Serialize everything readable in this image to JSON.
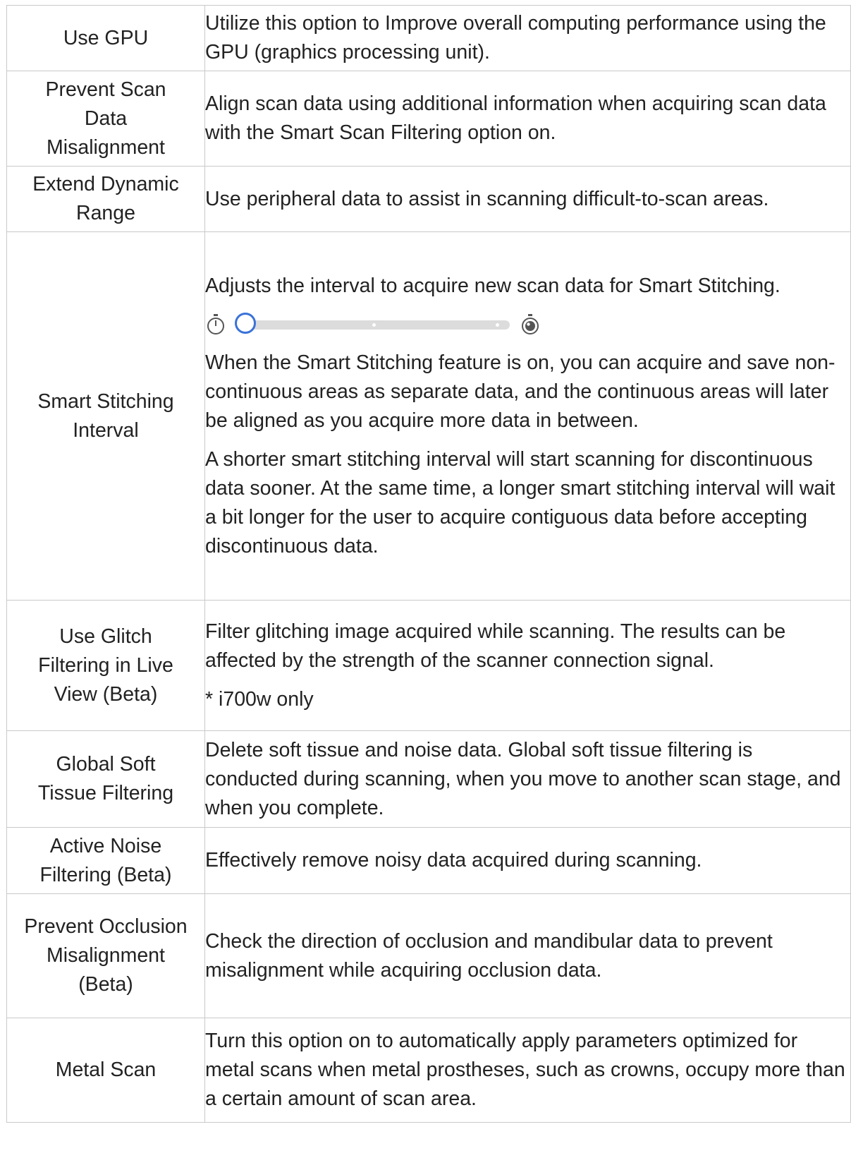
{
  "rows": [
    {
      "name": "Use GPU",
      "desc": [
        "Utilize this option to Improve overall computing performance using the GPU (graphics processing unit)."
      ]
    },
    {
      "name": "Prevent Scan Data Misalignment",
      "desc": [
        "Align scan data using additional information when acquiring scan data with the Smart Scan Filtering option on."
      ]
    },
    {
      "name": "Extend Dynamic Range",
      "desc": [
        "Use peripheral data to assist in scanning difficult-to-scan areas."
      ]
    },
    {
      "name": "Smart Stitching Interval",
      "desc": [
        "Adjusts the interval to acquire new scan data for Smart Stitching.",
        "When the Smart Stitching feature is on, you can acquire and save non-continuous areas as separate data, and the continuous areas will later be aligned as you acquire more data in between.",
        "A shorter smart stitching interval will start scanning for discontinuous data sooner. At the same time, a longer smart stitching interval will wait a bit longer for the user to acquire contiguous data before accepting discontinuous data."
      ],
      "slider": {
        "value_fraction": 0.0,
        "tick_count": 3,
        "left_icon": "stopwatch-outline-icon",
        "right_icon": "stopwatch-filled-icon",
        "accent": "#3a72d8"
      }
    },
    {
      "name": "Use Glitch Filtering in Live View (Beta)",
      "desc": [
        "Filter glitching image acquired while scanning. The results can be affected by the strength of the scanner connection signal.",
        "* i700w only"
      ]
    },
    {
      "name": "Global Soft Tissue Filtering",
      "desc": [
        "Delete soft tissue and noise data. Global soft tissue filtering is conducted during scanning, when you move to another scan stage, and when you complete."
      ]
    },
    {
      "name": "Active Noise Filtering (Beta)",
      "desc": [
        "Effectively remove noisy data acquired during scanning."
      ]
    },
    {
      "name": "Prevent Occlusion Misalignment (Beta)",
      "desc": [
        "Check the direction of occlusion and mandibular data to prevent misalignment while acquiring occlusion data."
      ]
    },
    {
      "name": "Metal Scan",
      "desc": [
        "Turn this option on to automatically apply parameters optimized for metal scans when metal prostheses, such as crowns, occupy more than a certain amount of scan area."
      ]
    }
  ]
}
